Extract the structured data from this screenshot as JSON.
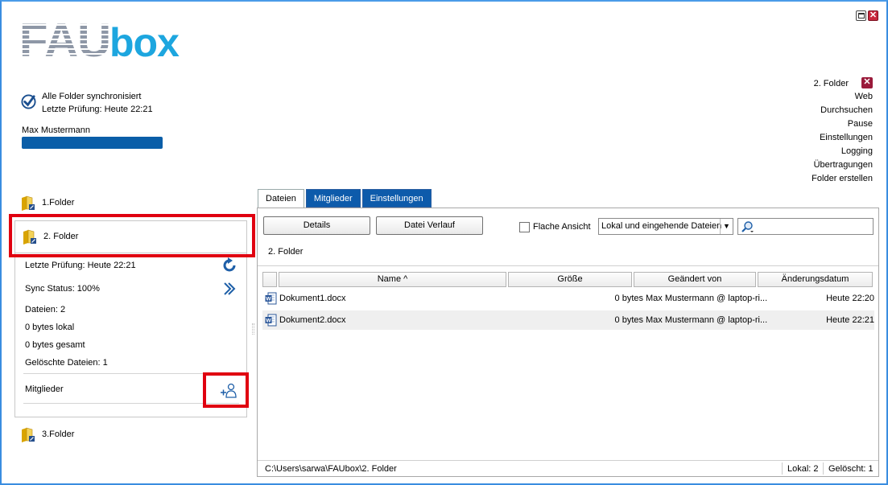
{
  "window": {
    "maximize_label": "",
    "close_label": "✕"
  },
  "logo": {
    "part1": "FAU",
    "part2": "bo",
    "part3": "x"
  },
  "status": {
    "sync_text": "Alle Folder synchronisiert",
    "last_check": "Letzte Prüfung: Heute 22:21",
    "user_name": "Max Mustermann"
  },
  "menu": {
    "current_folder": "2. Folder",
    "close_symbol": "✕",
    "items": [
      "Web",
      "Durchsuchen",
      "Pause",
      "Einstellungen",
      "Logging",
      "Übertragungen",
      "Folder erstellen"
    ]
  },
  "folders": {
    "f1": "1.Folder",
    "f2": "2. Folder",
    "f3": "3.Folder"
  },
  "folder_details": {
    "last_check": "Letzte Prüfung: Heute 22:21",
    "sync_status": "Sync Status: 100%",
    "files": "Dateien: 2",
    "local": "0 bytes lokal",
    "total": "0 bytes gesamt",
    "deleted": "Gelöschte Dateien: 1",
    "members": "Mitglieder"
  },
  "tabs": [
    "Dateien",
    "Mitglieder",
    "Einstellungen"
  ],
  "toolbar": {
    "details": "Details",
    "history": "Datei Verlauf",
    "flat_view": "Flache Ansicht",
    "filter_value": "Lokal und eingehende Dateien",
    "search_placeholder": ""
  },
  "breadcrumb": "2. Folder",
  "table": {
    "columns": [
      "Name ^",
      "Größe",
      "Geändert von",
      "Änderungsdatum"
    ],
    "rows": [
      {
        "name": "Dokument1.docx",
        "size": "0 bytes",
        "modified_by": "Max Mustermann @ laptop-ri...",
        "date": "Heute 22:20"
      },
      {
        "name": "Dokument2.docx",
        "size": "0 bytes",
        "modified_by": "Max Mustermann @ laptop-ri...",
        "date": "Heute 22:21"
      }
    ]
  },
  "statusbar": {
    "path": "C:\\Users\\sarwa\\FAUbox\\2. Folder",
    "local": "Lokal: 2",
    "deleted": "Gelöscht: 1"
  },
  "colors": {
    "accent": "#0d5bab",
    "logo_blue": "#1da6df",
    "highlight": "#e00010"
  }
}
